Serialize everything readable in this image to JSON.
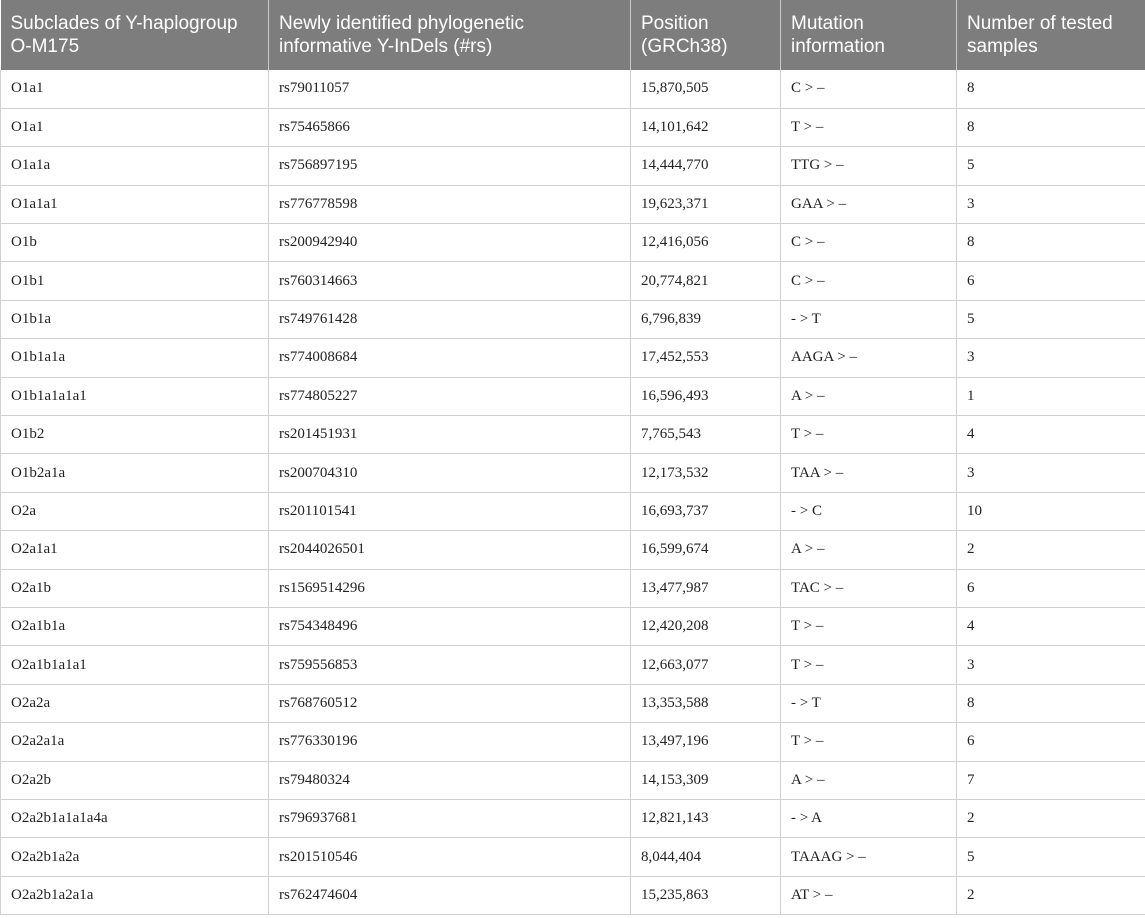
{
  "table": {
    "headers": [
      "Subclades of Y-haplogroup O-M175",
      "Newly identified phylogenetic informative Y-InDels (#rs)",
      "Position (GRCh38)",
      "Mutation information",
      "Number of tested samples"
    ],
    "rows": [
      [
        "O1a1",
        "rs79011057",
        "15,870,505",
        "C > –",
        "8"
      ],
      [
        "O1a1",
        "rs75465866",
        "14,101,642",
        "T > –",
        "8"
      ],
      [
        "O1a1a",
        "rs756897195",
        "14,444,770",
        "TTG > –",
        "5"
      ],
      [
        "O1a1a1",
        "rs776778598",
        "19,623,371",
        "GAA > –",
        "3"
      ],
      [
        "O1b",
        "rs200942940",
        "12,416,056",
        "C > –",
        "8"
      ],
      [
        "O1b1",
        "rs760314663",
        "20,774,821",
        "C > –",
        "6"
      ],
      [
        "O1b1a",
        "rs749761428",
        "6,796,839",
        "- > T",
        "5"
      ],
      [
        "O1b1a1a",
        "rs774008684",
        "17,452,553",
        "AAGA > –",
        "3"
      ],
      [
        "O1b1a1a1a1",
        "rs774805227",
        "16,596,493",
        "A > –",
        "1"
      ],
      [
        "O1b2",
        "rs201451931",
        "7,765,543",
        "T > –",
        "4"
      ],
      [
        "O1b2a1a",
        "rs200704310",
        "12,173,532",
        "TAA > –",
        "3"
      ],
      [
        "O2a",
        "rs201101541",
        "16,693,737",
        "- > C",
        "10"
      ],
      [
        "O2a1a1",
        "rs2044026501",
        "16,599,674",
        "A > –",
        "2"
      ],
      [
        "O2a1b",
        "rs1569514296",
        "13,477,987",
        "TAC > –",
        "6"
      ],
      [
        "O2a1b1a",
        "rs754348496",
        "12,420,208",
        "T > –",
        "4"
      ],
      [
        "O2a1b1a1a1",
        "rs759556853",
        "12,663,077",
        "T > –",
        "3"
      ],
      [
        "O2a2a",
        "rs768760512",
        "13,353,588",
        "- > T",
        "8"
      ],
      [
        "O2a2a1a",
        "rs776330196",
        "13,497,196",
        "T > –",
        "6"
      ],
      [
        "O2a2b",
        "rs79480324",
        "14,153,309",
        "A > –",
        "7"
      ],
      [
        "O2a2b1a1a1a4a",
        "rs796937681",
        "12,821,143",
        "- > A",
        "2"
      ],
      [
        "O2a2b1a2a",
        "rs201510546",
        "8,044,404",
        "TAAAG > –",
        "5"
      ],
      [
        "O2a2b1a2a1a",
        "rs762474604",
        "15,235,863",
        "AT > –",
        "2"
      ]
    ]
  }
}
